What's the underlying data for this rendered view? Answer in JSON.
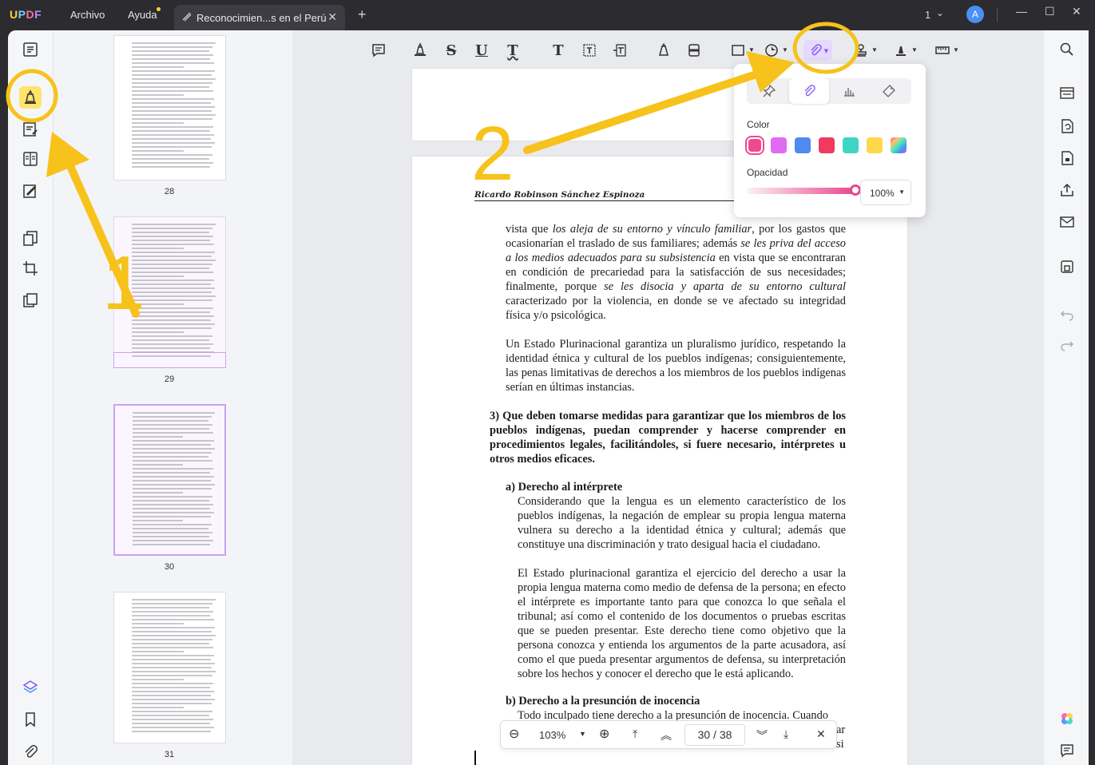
{
  "titlebar": {
    "menu_archivo": "Archivo",
    "menu_ayuda": "Ayuda",
    "tab_title": "Reconocimien...s en el Perú",
    "page_indicator": "1",
    "avatar_letter": "A",
    "logo": "UPDF"
  },
  "thumbnails": [
    {
      "number": "28"
    },
    {
      "number": "29"
    },
    {
      "number": "30"
    },
    {
      "number": "31"
    }
  ],
  "document": {
    "running_head": "Ricardo Robinson Sánchez Espinoza",
    "para1_a": "vista que ",
    "para1_b": "los aleja de su entorno y vínculo familiar",
    "para1_c": ", por los gastos que ocasionarían el traslado de sus familiares; además ",
    "para1_d": "se les priva del acceso a los medios adecuados para su subsistencia",
    "para1_e": " en vista que se encontraran en condición de precariedad para la satisfacción de sus necesidades; finalmente, porque ",
    "para1_f": "se les disocia y aparta de su entorno cultural",
    "para1_g": " caracterizado por la violencia, en donde se ve afectado su integridad física y/o psicológica.",
    "para2": "Un Estado Plurinacional garantiza un pluralismo jurídico, respetando la identidad étnica y cultural de los pueblos indígenas; consiguientemente, las penas limitativas de derechos a los miembros de los pueblos indígenas serían en últimas instancias.",
    "heading3": "3) Que deben tomarse medidas para garantizar  que los miembros de los pueblos indígenas, puedan comprender y hacerse comprender en procedimientos legales, facilitándoles, si fuere necesario, intérpretes u otros medios eficaces.",
    "subheading_a": "a) Derecho al intérprete",
    "para_a1": "Considerando que la lengua es un elemento característico de los pueblos indígenas, la negación de emplear su propia lengua materna vulnera su derecho a la identidad étnica y cultural; además que constituye una discriminación y trato desigual hacia el ciudadano.",
    "para_a2": "El Estado plurinacional garantiza el ejercicio del derecho a usar la propia lengua materna como medio de defensa de la persona; en efecto el intérprete es importante tanto para que conozca lo que señala el tribunal; así como el contenido de los documentos o pruebas escritas que se pueden presentar. Este derecho tiene como objetivo que la persona conozca y entienda los argumentos de la parte acusadora, así como el que pueda presentar argumentos de defensa, su interpretación sobre los hechos y conocer el derecho que le está aplicando.",
    "subheading_b": "b) Derecho a la presunción de inocencia",
    "para_b1": "Todo inculpado tiene derecho a la presunción de inocencia. Cuando",
    "tail_1": "ar",
    "tail_2": "si"
  },
  "attachment_popup": {
    "color_label": "Color",
    "opacity_label": "Opacidad",
    "opacity_value": "100%",
    "opacity_fraction": 1.0,
    "swatches": [
      "#f0498f",
      "#e06bf0",
      "#4f8af0",
      "#f03a5f",
      "#3ed6c2",
      "#ffd84a",
      "rainbow"
    ],
    "selected_swatch": "#f0498f"
  },
  "pagenav": {
    "zoom": "103%",
    "current_page": "30",
    "separator": "/",
    "total_pages": "38"
  },
  "annotations": {
    "step1": "1",
    "step2": "2",
    "highlight_color": "#f6c21b"
  }
}
